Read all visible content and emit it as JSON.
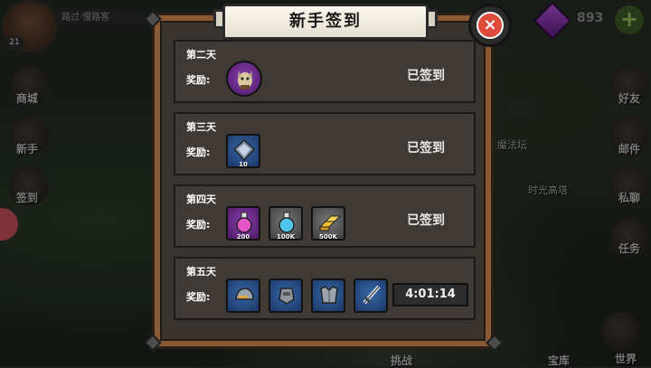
{
  "window": {
    "title": "新手签到"
  },
  "player": {
    "name": "路过·慢路客",
    "level": "21"
  },
  "currency": {
    "gems": "893",
    "add_label": "+"
  },
  "side_menu": {
    "left": [
      "商城",
      "新手",
      "签到"
    ],
    "right": [
      "好友",
      "邮件",
      "私聊",
      "任务",
      "世界"
    ]
  },
  "map_labels": [
    "魔法坛",
    "时光高塔"
  ],
  "bottom_labels": [
    "挑战",
    "宝库",
    "世界"
  ],
  "close_label": "×",
  "reward_label": "奖励:",
  "days": [
    {
      "day": "第二天",
      "status": "已签到",
      "items": [
        {
          "icon": "knight-character-icon",
          "rarity": "purple-round",
          "qty": ""
        }
      ]
    },
    {
      "day": "第三天",
      "status": "已签到",
      "items": [
        {
          "icon": "blue-gem-icon",
          "rarity": "blue",
          "qty": "10"
        }
      ]
    },
    {
      "day": "第四天",
      "status": "已签到",
      "items": [
        {
          "icon": "pink-potion-icon",
          "rarity": "purple",
          "qty": "200"
        },
        {
          "icon": "blue-potion-icon",
          "rarity": "grey",
          "qty": "100K"
        },
        {
          "icon": "gold-bars-icon",
          "rarity": "grey",
          "qty": "500K"
        }
      ]
    },
    {
      "day": "第五天",
      "status": "4:01:14",
      "items": [
        {
          "icon": "helmet-icon",
          "rarity": "blue",
          "qty": ""
        },
        {
          "icon": "gauntlet-icon",
          "rarity": "blue",
          "qty": ""
        },
        {
          "icon": "armor-icon",
          "rarity": "blue",
          "qty": ""
        },
        {
          "icon": "sword-icon",
          "rarity": "blue",
          "qty": ""
        }
      ]
    }
  ],
  "colors": {
    "frame": "#8a5a34",
    "row_bg": "#403a36",
    "close_red": "#e04a3a",
    "title_bg": "#fbf7ee"
  }
}
